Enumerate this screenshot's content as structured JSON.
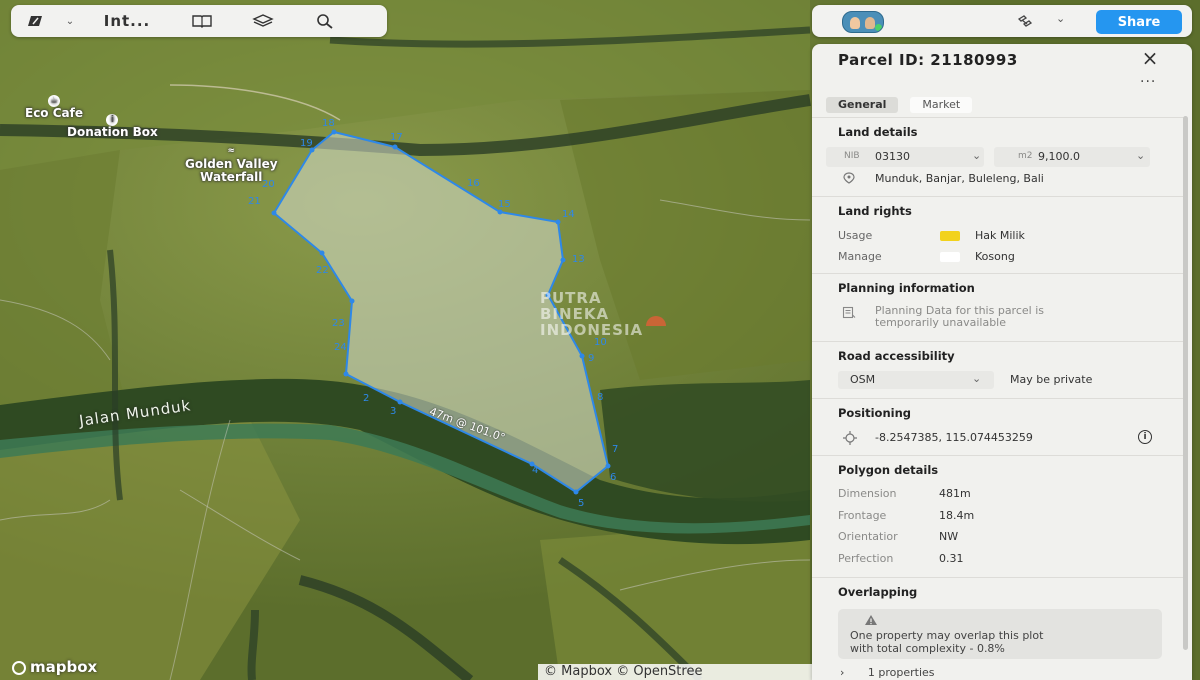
{
  "toolbar": {
    "title": "Int...",
    "icons": [
      "draw-icon",
      "chevron-down-icon",
      "book-icon",
      "layers-icon",
      "search-icon"
    ]
  },
  "topbar": {
    "share_label": "Share",
    "icons": [
      "avatar",
      "satellite-icon",
      "chevron-down-icon"
    ]
  },
  "map": {
    "labels": {
      "eco_cafe": "Eco Cafe",
      "donation_box": "Donation Box",
      "waterfall": "Golden Valley\nWaterfall",
      "road": "Jalan Munduk"
    },
    "measurement": "47m @ 101.0°",
    "vertex_labels": [
      "2",
      "3",
      "4",
      "5",
      "6",
      "7",
      "8",
      "9",
      "10",
      "13",
      "14",
      "15",
      "16",
      "17",
      "18",
      "19",
      "20",
      "21",
      "22",
      "23",
      "24"
    ],
    "watermark": [
      "PUTRA",
      "BINEKA",
      "INDONESIA"
    ],
    "logo": "mapbox",
    "attribution": "© Mapbox © OpenStree"
  },
  "panel": {
    "title": "Parcel ID: 21180993",
    "tabs": [
      {
        "label": "General",
        "active": true
      },
      {
        "label": "Market",
        "active": false
      }
    ],
    "land_details": {
      "heading": "Land details",
      "nib_label": "NIB",
      "nib_value": "03130",
      "area_unit": "m2",
      "area_value": "9,100.0",
      "location": "Munduk, Banjar, Buleleng, Bali"
    },
    "land_rights": {
      "heading": "Land rights",
      "usage_label": "Usage",
      "usage_value": "Hak Milik",
      "usage_color": "#f2d21c",
      "manage_label": "Manage",
      "manage_value": "Kosong",
      "manage_color": "#ffffff"
    },
    "planning": {
      "heading": "Planning information",
      "message_line1": "Planning Data for this parcel is",
      "message_line2": "temporarily unavailable"
    },
    "road": {
      "heading": "Road accessibility",
      "source": "OSM",
      "status": "May be private"
    },
    "positioning": {
      "heading": "Positioning",
      "coordinates": "-8.2547385, 115.074453259"
    },
    "polygon": {
      "heading": "Polygon details",
      "rows": [
        {
          "label": "Dimension",
          "value": "481m"
        },
        {
          "label": "Frontage",
          "value": "18.4m"
        },
        {
          "label": "Orientatior",
          "value": "NW"
        },
        {
          "label": "Perfection",
          "value": "0.31"
        }
      ]
    },
    "overlapping": {
      "heading": "Overlapping",
      "warning_line1": "One property may overlap this plot",
      "warning_line2": "with total complexity - 0.8%",
      "properties": "1 properties"
    }
  }
}
